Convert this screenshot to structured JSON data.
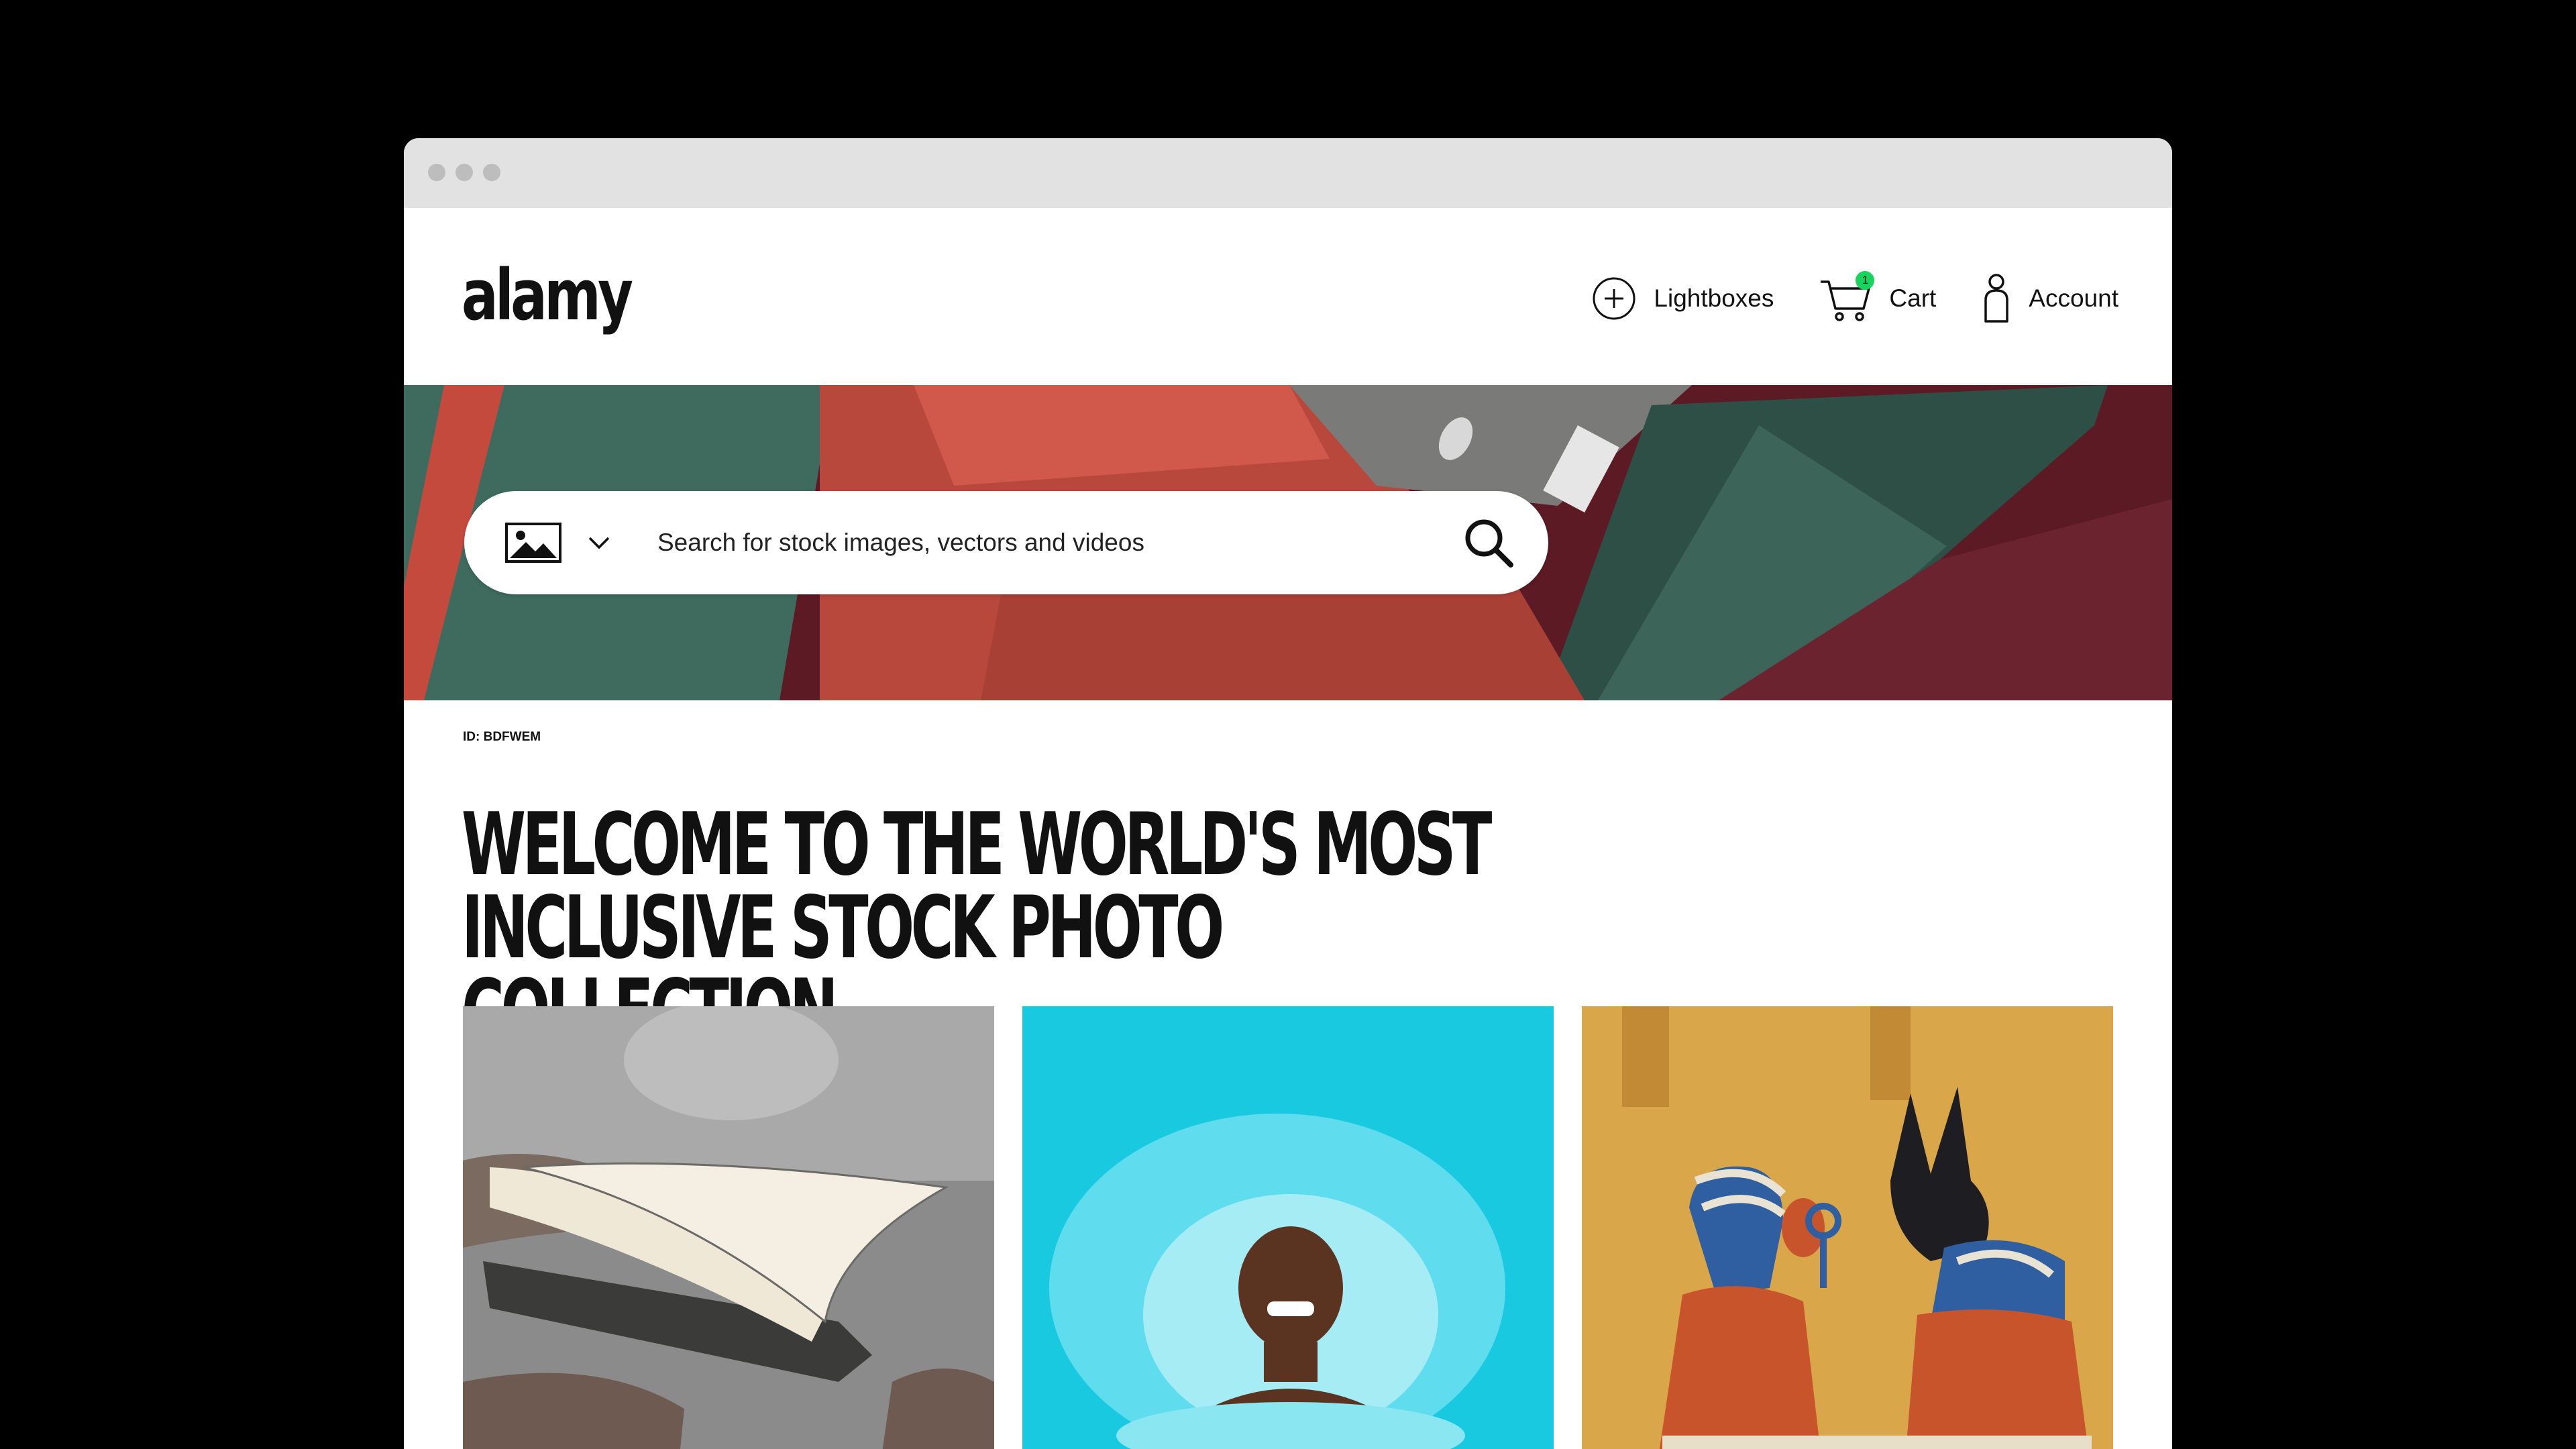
{
  "browser": {
    "window_controls": [
      "close",
      "minimize",
      "maximize"
    ]
  },
  "header": {
    "logo": "alamy",
    "nav": {
      "lightboxes": "Lightboxes",
      "cart": "Cart",
      "cart_count": "1",
      "account": "Account"
    }
  },
  "search": {
    "type_icon": "image-icon",
    "placeholder": "Search for stock images, vectors and videos"
  },
  "hero": {
    "image_id": "ID: BDFWEM"
  },
  "headline": {
    "line1": "Welcome to the world's most",
    "line2": "inclusive stock photo collection"
  },
  "colors": {
    "badge": "#19d45c",
    "bridge": "#c7463c",
    "pool": "#18c9e0",
    "mural": "#d9a64a"
  }
}
